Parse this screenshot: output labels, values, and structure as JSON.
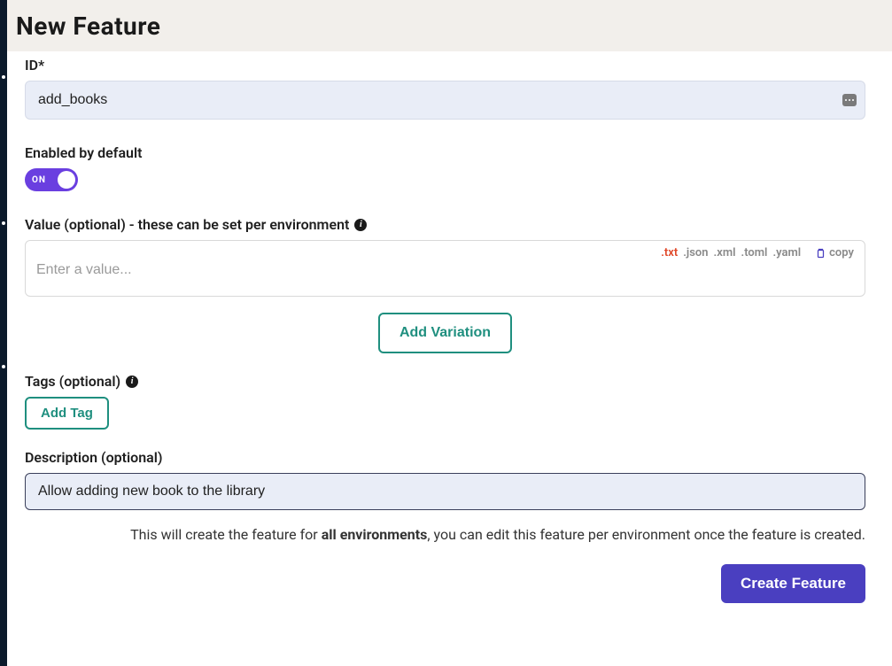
{
  "header": {
    "title": "New Feature"
  },
  "fields": {
    "id": {
      "label": "ID*",
      "value": "add_books"
    },
    "enabled": {
      "label": "Enabled by default",
      "toggle_text": "ON",
      "on": true
    },
    "value": {
      "label": "Value (optional) - these can be set per environment",
      "placeholder": "Enter a value...",
      "formats": [
        ".txt",
        ".json",
        ".xml",
        ".toml",
        ".yaml"
      ],
      "active_format": ".txt",
      "copy_label": "copy"
    },
    "add_variation": {
      "label": "Add Variation"
    },
    "tags": {
      "label": "Tags (optional)",
      "add_label": "Add Tag"
    },
    "description": {
      "label": "Description (optional)",
      "value": "Allow adding new book to the library"
    }
  },
  "note": {
    "pre": "This will create the feature for ",
    "bold": "all environments",
    "post": ", you can edit this feature per environment once the feature is created."
  },
  "actions": {
    "create": "Create Feature"
  }
}
